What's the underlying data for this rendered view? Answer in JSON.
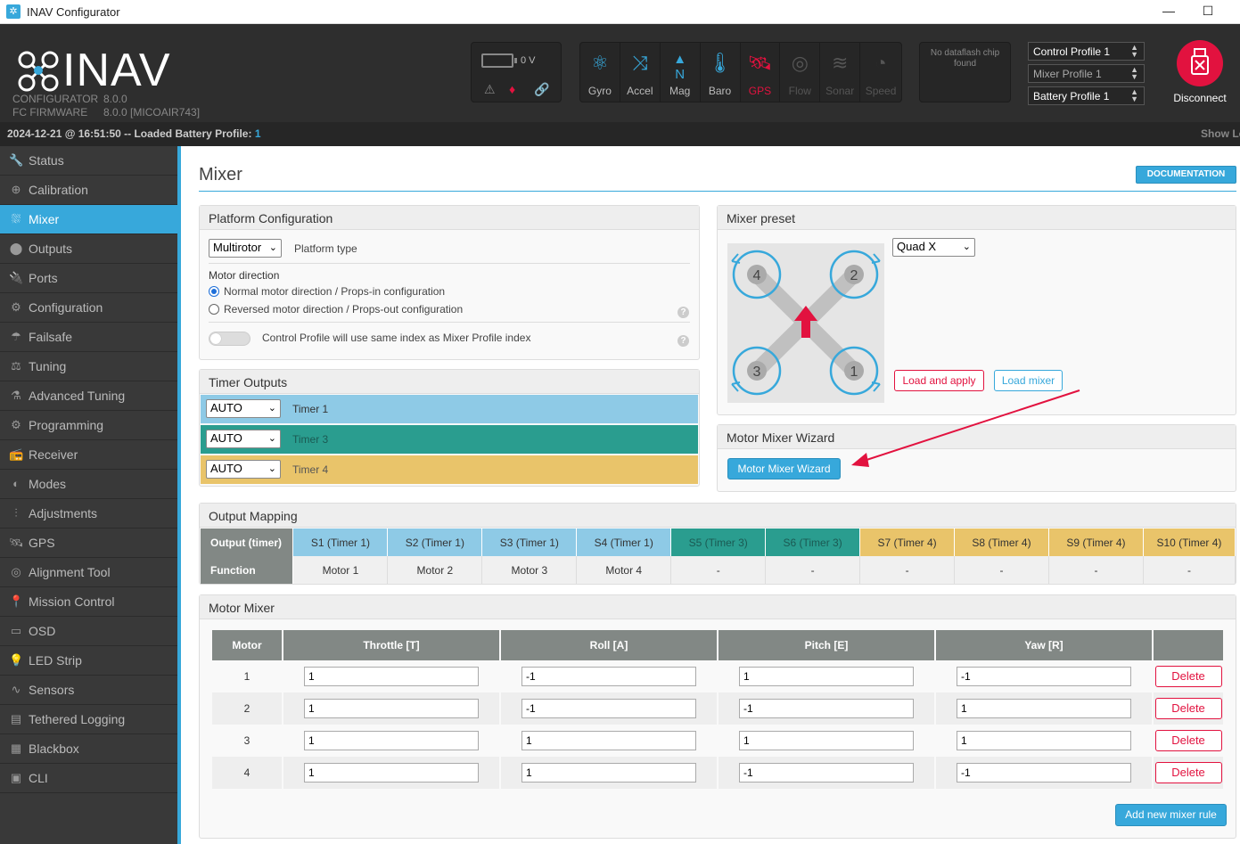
{
  "window": {
    "title": "INAV Configurator",
    "minimize": "—",
    "maximize": "☐"
  },
  "header": {
    "logo_text": "INAV",
    "configurator_label": "CONFIGURATOR",
    "configurator_version": "8.0.0",
    "firmware_label": "FC FIRMWARE",
    "firmware_version": "8.0.0 [MICOAIR743]",
    "battery_voltage": "0 V",
    "sensors": [
      {
        "label": "Gyro",
        "state": "on",
        "icon": "gyro-icon"
      },
      {
        "label": "Accel",
        "state": "on",
        "icon": "accel-icon"
      },
      {
        "label": "Mag",
        "state": "on",
        "icon": "mag-icon"
      },
      {
        "label": "Baro",
        "state": "on",
        "icon": "baro-icon"
      },
      {
        "label": "GPS",
        "state": "error",
        "icon": "gps-icon"
      },
      {
        "label": "Flow",
        "state": "off",
        "icon": "flow-icon"
      },
      {
        "label": "Sonar",
        "state": "off",
        "icon": "sonar-icon"
      },
      {
        "label": "Speed",
        "state": "off",
        "icon": "speed-icon"
      }
    ],
    "dataflash": "No dataflash chip found",
    "control_profile": "Control Profile 1",
    "mixer_profile": "Mixer Profile 1",
    "battery_profile": "Battery Profile 1",
    "disconnect_label": "Disconnect"
  },
  "statusbar": {
    "message": "2024-12-21 @ 16:51:50 -- Loaded Battery Profile: ",
    "profile_number": "1",
    "show_log": "Show Log"
  },
  "sidebar": {
    "items": [
      {
        "label": "Status",
        "icon": "wrench-icon"
      },
      {
        "label": "Calibration",
        "icon": "crosshair-icon"
      },
      {
        "label": "Mixer",
        "icon": "mixer-icon",
        "active": true
      },
      {
        "label": "Outputs",
        "icon": "motor-icon"
      },
      {
        "label": "Ports",
        "icon": "plug-icon"
      },
      {
        "label": "Configuration",
        "icon": "gear-icon"
      },
      {
        "label": "Failsafe",
        "icon": "parachute-icon"
      },
      {
        "label": "Tuning",
        "icon": "tuning-icon"
      },
      {
        "label": "Advanced Tuning",
        "icon": "advanced-tuning-icon"
      },
      {
        "label": "Programming",
        "icon": "programming-gear-icon"
      },
      {
        "label": "Receiver",
        "icon": "receiver-icon"
      },
      {
        "label": "Modes",
        "icon": "toggle-icon"
      },
      {
        "label": "Adjustments",
        "icon": "sliders-icon"
      },
      {
        "label": "GPS",
        "icon": "satellite-icon"
      },
      {
        "label": "Alignment Tool",
        "icon": "compass-icon"
      },
      {
        "label": "Mission Control",
        "icon": "map-pin-icon"
      },
      {
        "label": "OSD",
        "icon": "osd-icon"
      },
      {
        "label": "LED Strip",
        "icon": "led-icon"
      },
      {
        "label": "Sensors",
        "icon": "sensors-icon"
      },
      {
        "label": "Tethered Logging",
        "icon": "log-icon"
      },
      {
        "label": "Blackbox",
        "icon": "blackbox-icon"
      },
      {
        "label": "CLI",
        "icon": "terminal-icon"
      }
    ]
  },
  "main": {
    "title": "Mixer",
    "documentation_button": "DOCUMENTATION",
    "platform": {
      "header": "Platform Configuration",
      "platform_value": "Multirotor",
      "platform_label": "Platform type",
      "motor_direction_label": "Motor direction",
      "normal_direction": "Normal motor direction / Props-in configuration",
      "reversed_direction": "Reversed motor direction / Props-out configuration",
      "profile_toggle_label": "Control Profile will use same index as Mixer Profile index"
    },
    "timer_outputs": {
      "header": "Timer Outputs",
      "rows": [
        {
          "value": "AUTO",
          "label": "Timer 1",
          "color": "#8ecae6"
        },
        {
          "value": "AUTO",
          "label": "Timer 3",
          "color": "#2a9d8f"
        },
        {
          "value": "AUTO",
          "label": "Timer 4",
          "color": "#e9c46a"
        }
      ]
    },
    "mixer_preset": {
      "header": "Mixer preset",
      "preset_value": "Quad X",
      "motor_labels": [
        "4",
        "2",
        "3",
        "1"
      ],
      "load_apply_button": "Load and apply",
      "load_mixer_button": "Load mixer"
    },
    "wizard": {
      "header": "Motor Mixer Wizard",
      "button": "Motor Mixer Wizard"
    },
    "output_mapping": {
      "header": "Output Mapping",
      "row1_head": "Output (timer)",
      "row2_head": "Function",
      "outputs": [
        {
          "label": "S1 (Timer 1)",
          "function": "Motor 1",
          "group": "t1"
        },
        {
          "label": "S2 (Timer 1)",
          "function": "Motor 2",
          "group": "t1"
        },
        {
          "label": "S3 (Timer 1)",
          "function": "Motor 3",
          "group": "t1"
        },
        {
          "label": "S4 (Timer 1)",
          "function": "Motor 4",
          "group": "t1"
        },
        {
          "label": "S5 (Timer 3)",
          "function": "-",
          "group": "t3"
        },
        {
          "label": "S6 (Timer 3)",
          "function": "-",
          "group": "t3"
        },
        {
          "label": "S7 (Timer 4)",
          "function": "-",
          "group": "t4"
        },
        {
          "label": "S8 (Timer 4)",
          "function": "-",
          "group": "t4"
        },
        {
          "label": "S9 (Timer 4)",
          "function": "-",
          "group": "t4"
        },
        {
          "label": "S10 (Timer 4)",
          "function": "-",
          "group": "t4"
        }
      ]
    },
    "motor_mixer": {
      "header": "Motor Mixer",
      "columns": [
        "Motor",
        "Throttle [T]",
        "Roll [A]",
        "Pitch [E]",
        "Yaw [R]"
      ],
      "rows": [
        {
          "motor": "1",
          "throttle": "1",
          "roll": "-1",
          "pitch": "1",
          "yaw": "-1"
        },
        {
          "motor": "2",
          "throttle": "1",
          "roll": "-1",
          "pitch": "-1",
          "yaw": "1"
        },
        {
          "motor": "3",
          "throttle": "1",
          "roll": "1",
          "pitch": "1",
          "yaw": "1"
        },
        {
          "motor": "4",
          "throttle": "1",
          "roll": "1",
          "pitch": "-1",
          "yaw": "-1"
        }
      ],
      "delete_label": "Delete",
      "add_rule_button": "Add new mixer rule"
    }
  },
  "colors": {
    "accent": "#37a8db",
    "danger": "#e2123f",
    "annotation_arrow": "#e2123f"
  }
}
